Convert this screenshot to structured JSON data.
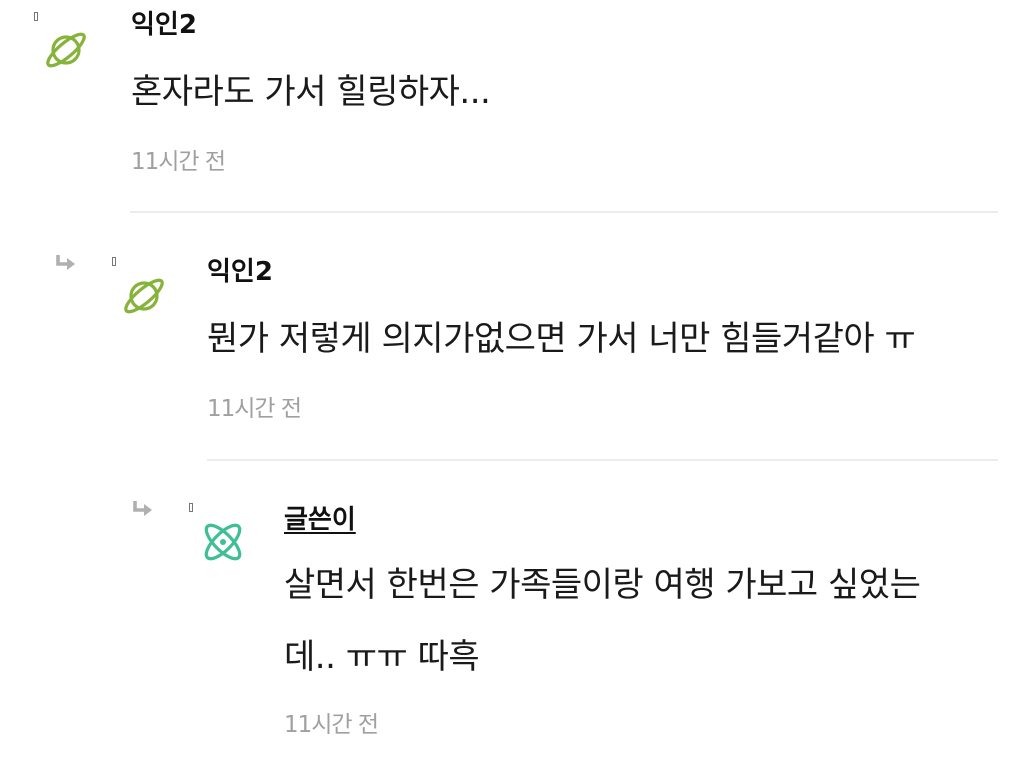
{
  "comments": [
    {
      "author": "익인2",
      "text": "혼자라도 가서 힐링하자...",
      "time": "11시간 전",
      "avatar_icon": "planet-icon",
      "avatar_color": "#86b33a"
    },
    {
      "author": "익인2",
      "text": "뭔가 저렇게 의지가없으면 가서 너만 힘들거같아 ㅠ",
      "time": "11시간 전",
      "avatar_icon": "planet-icon",
      "avatar_color": "#86b33a",
      "reply_icon": "reply-arrow-icon"
    },
    {
      "author": "글쓴이",
      "text": "살면서 한번은 가족들이랑 여행 가보고 싶었는\n데.. ㅠㅠ 따흑",
      "time": "11시간 전",
      "avatar_icon": "atom-icon",
      "avatar_color": "#3fbf93",
      "reply_icon": "reply-arrow-icon"
    }
  ]
}
